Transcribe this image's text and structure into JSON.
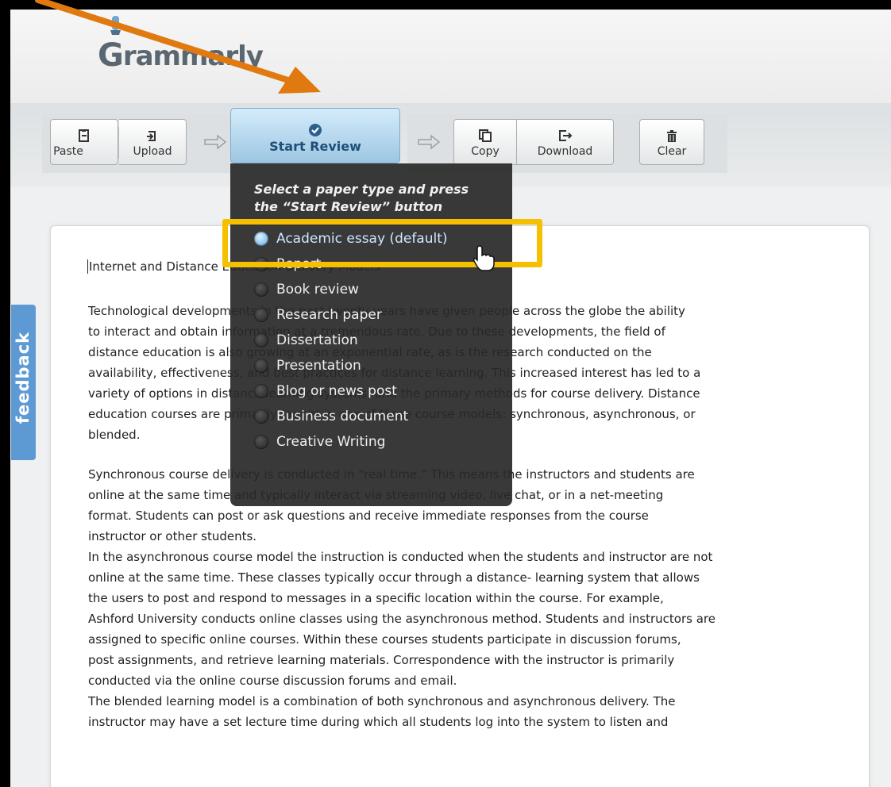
{
  "app": {
    "logo_text": "rammarly",
    "logo_letter": "G"
  },
  "toolbar": {
    "paste_label": "Paste",
    "upload_label": "Upload",
    "start_review_label": "Start Review",
    "copy_label": "Copy",
    "download_label": "Download",
    "clear_label": "Clear"
  },
  "feedback_tab": {
    "label": "feedback"
  },
  "dropdown": {
    "title": "Select a paper type and press the “Start Review” button",
    "options": [
      {
        "label": "Academic essay (default)",
        "selected": true
      },
      {
        "label": "Report",
        "selected": false
      },
      {
        "label": "Book review",
        "selected": false
      },
      {
        "label": "Research paper",
        "selected": false
      },
      {
        "label": "Dissertation",
        "selected": false
      },
      {
        "label": "Presentation",
        "selected": false
      },
      {
        "label": "Blog or news post",
        "selected": false
      },
      {
        "label": "Business document",
        "selected": false
      },
      {
        "label": "Creative Writing",
        "selected": false
      }
    ]
  },
  "document": {
    "title": "Internet and Distance Education Delivery Models",
    "paragraphs": [
      [
        "Technological developments in the past twenty years have given people across the globe the ability",
        "to interact and obtain information at a tremendous rate. Due to these developments, the field of",
        "distance education is also growing at an exponential rate, as is the research conducted on the",
        "availability, effectiveness, and best practices for distance learning. This increased interest has led to a",
        "variety of options in distance learning systems, and the primary methods for course delivery. Distance",
        "education courses are primarily taught in one of three course models: synchronous, asynchronous, or",
        "blended."
      ],
      [
        "Synchronous course delivery is conducted in “real time.” This means the instructors and students are",
        "online at the same time and typically interact via streaming video, live chat, or in a net-meeting",
        "format. Students can post or ask questions and receive immediate responses from the course",
        "instructor or other students."
      ],
      [
        "In the asynchronous course model the instruction is conducted when the students and instructor are not",
        "online at the same time. These classes typically occur through a distance- learning system that allows",
        "the users to post and respond to messages in a specific location within the course. For example,",
        "Ashford University conducts online classes using the asynchronous method. Students and instructors are",
        "assigned to specific online courses. Within these courses students participate in discussion forums,",
        "post assignments, and retrieve learning materials. Correspondence with the instructor is primarily",
        "conducted via the online course discussion forums and email."
      ],
      [
        "The blended learning model is a combination of both synchronous and asynchronous delivery. The",
        "instructor may have a set lecture time during which all students log into the system to listen and"
      ]
    ]
  },
  "colors": {
    "highlight_box": "#f5c000",
    "callout_arrow": "#e07a10",
    "feedback_tab": "#5d9ad4",
    "start_review_text": "#1f4f78"
  }
}
